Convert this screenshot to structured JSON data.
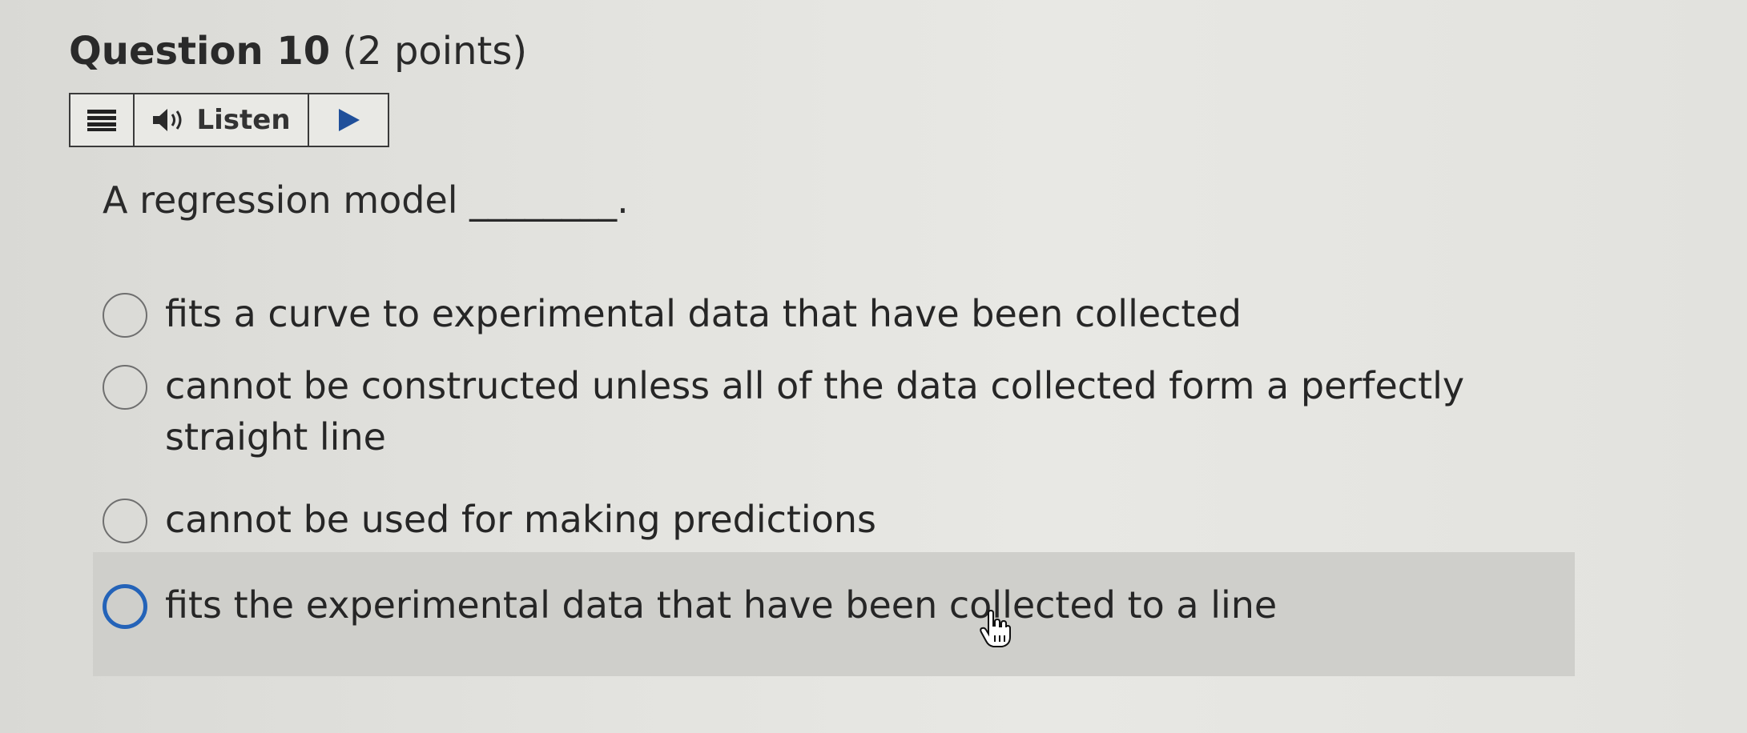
{
  "question": {
    "number_label": "Question 10",
    "points_label": "(2 points)"
  },
  "toolbar": {
    "menu_icon": "menu-lines-icon",
    "speaker_icon": "speaker-icon",
    "listen_label": "Listen",
    "play_icon": "play-icon"
  },
  "prompt": "A regression model ________.",
  "options": [
    {
      "text": "fits a curve to experimental data that have been collected",
      "selected": false
    },
    {
      "text": "cannot be constructed unless all of the data collected form a perfectly straight line",
      "selected": false
    },
    {
      "text": "cannot be used for making predictions",
      "selected": false
    },
    {
      "text": "fits the experimental data that have been collected to a line",
      "selected": false,
      "hovered": true
    }
  ],
  "colors": {
    "active_radio": "#2463b8",
    "hover_bg": "#cfcfcb"
  }
}
